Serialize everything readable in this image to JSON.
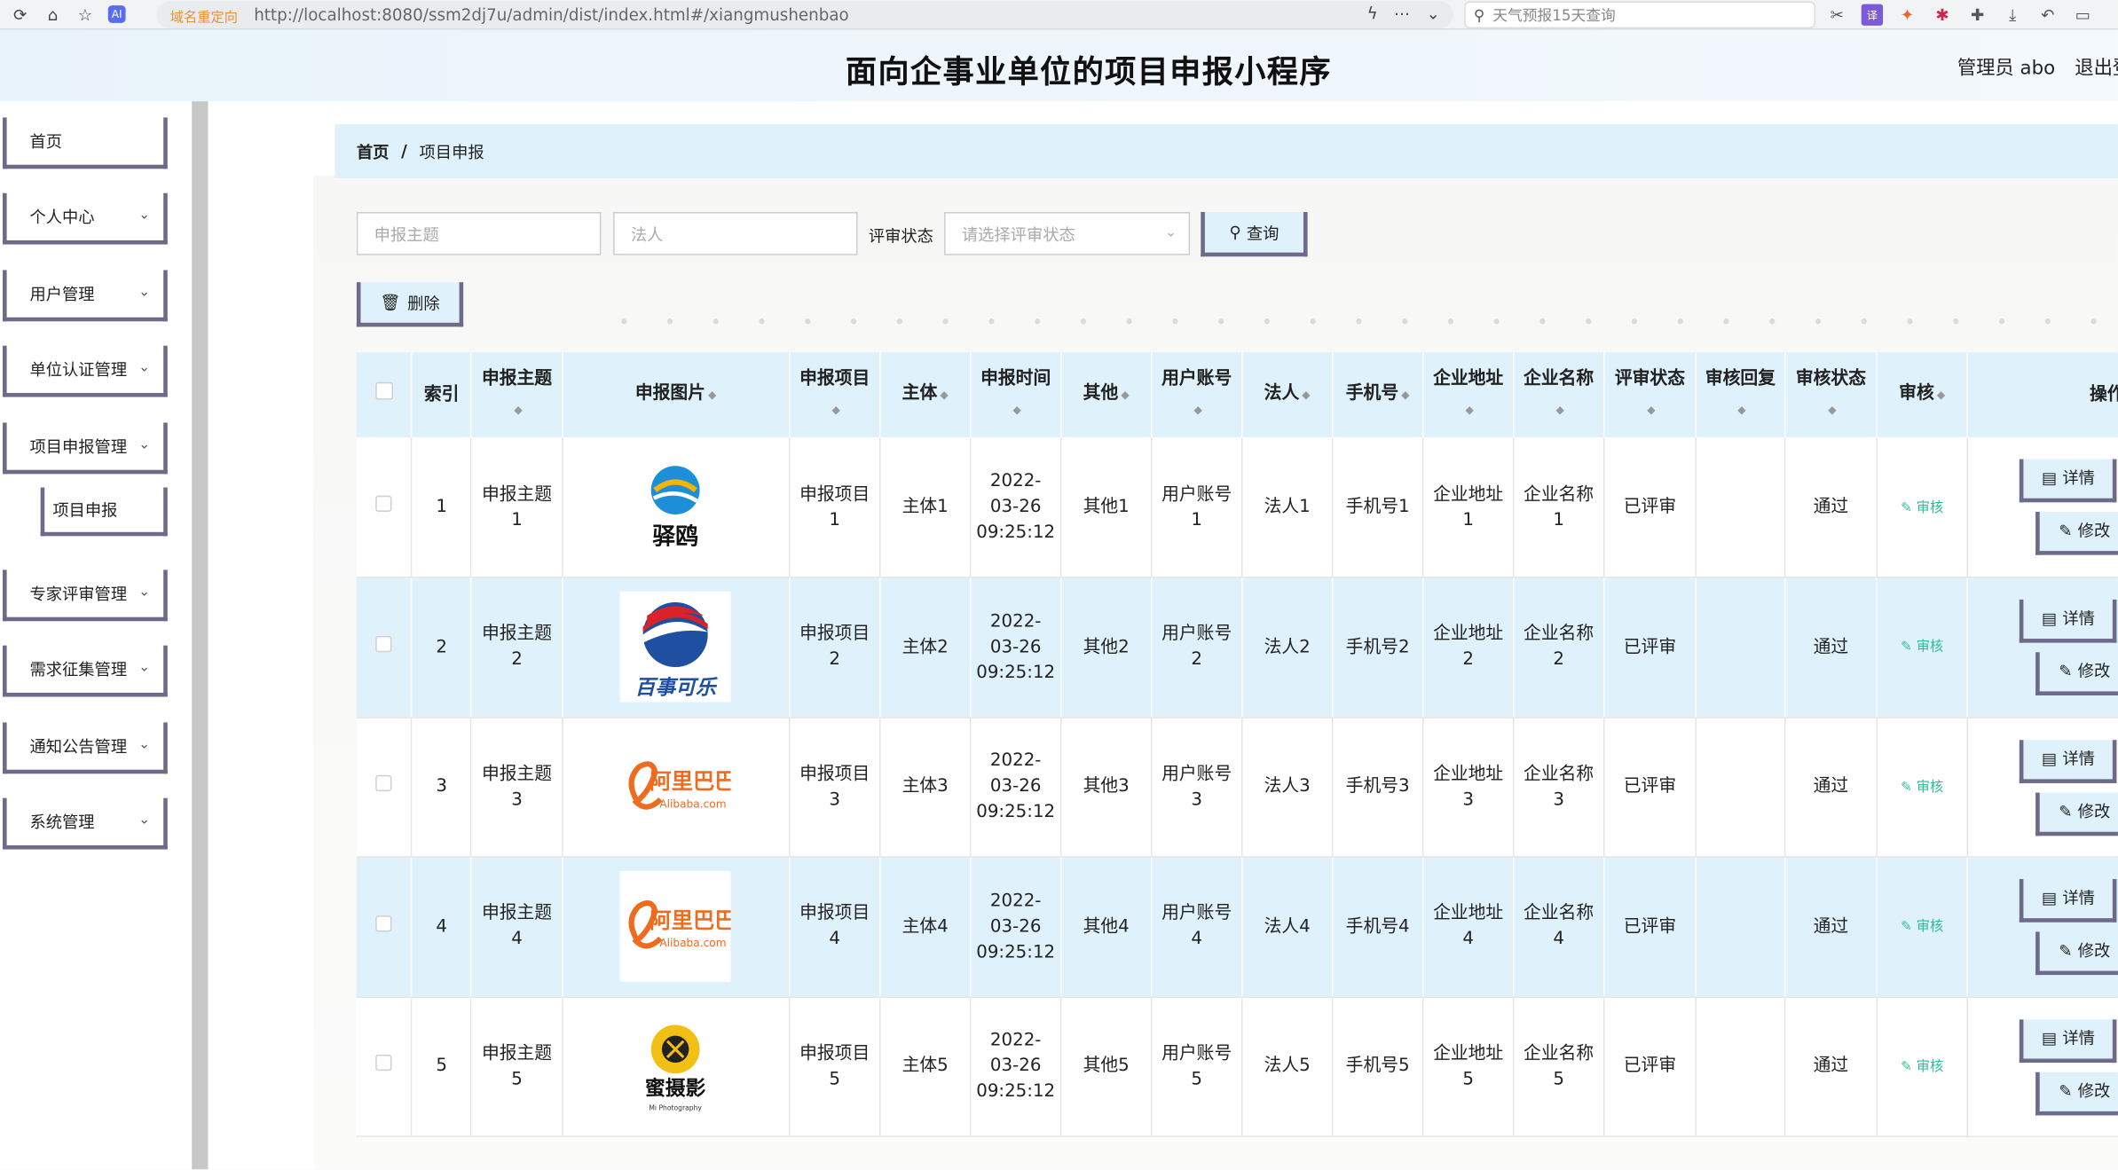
{
  "browser": {
    "redirect_label": "域名重定向",
    "url": "http://localhost:8080/ssm2dj7u/admin/dist/index.html#/xiangmushenbao",
    "search_placeholder": "天气预报15天查询",
    "ai_label": "AI"
  },
  "header": {
    "title": "面向企事业单位的项目申报小程序",
    "user": "管理员 abo",
    "logout": "退出登"
  },
  "sidebar": {
    "items": [
      {
        "label": "首页",
        "has_chevron": false
      },
      {
        "label": "个人中心",
        "has_chevron": true
      },
      {
        "label": "用户管理",
        "has_chevron": true
      },
      {
        "label": "单位认证管理",
        "has_chevron": true
      },
      {
        "label": "项目申报管理",
        "has_chevron": true
      },
      {
        "label": "项目申报",
        "sub": true
      },
      {
        "label": "专家评审管理",
        "has_chevron": true
      },
      {
        "label": "需求征集管理",
        "has_chevron": true
      },
      {
        "label": "通知公告管理",
        "has_chevron": true
      },
      {
        "label": "系统管理",
        "has_chevron": true
      }
    ]
  },
  "breadcrumb": {
    "home": "首页",
    "separator": "/",
    "current": "项目申报"
  },
  "filters": {
    "subject_placeholder": "申报主题",
    "legal_placeholder": "法人",
    "status_label": "评审状态",
    "status_placeholder": "请选择评审状态",
    "query_label": "查询",
    "delete_label": "删除"
  },
  "table": {
    "headers": [
      "索引",
      "申报主题",
      "申报图片",
      "申报项目",
      "主体",
      "申报时间",
      "其他",
      "用户账号",
      "法人",
      "手机号",
      "企业地址",
      "企业名称",
      "评审状态",
      "审核回复",
      "审核状态",
      "审核",
      "操作"
    ],
    "detail_label": "详情",
    "edit_label": "修改",
    "audit_label": "审核",
    "rows": [
      {
        "idx": "1",
        "subject": "申报主题1",
        "logo": "yiyi",
        "logo_text": "驿鸥",
        "project": "申报项目1",
        "body": "主体1",
        "time": "2022-03-26 09:25:12",
        "other": "其他1",
        "account": "用户账号1",
        "legal": "法人1",
        "phone": "手机号1",
        "address": "企业地址1",
        "company": "企业名称1",
        "review": "已评审",
        "reply": "",
        "status": "通过"
      },
      {
        "idx": "2",
        "subject": "申报主题2",
        "logo": "pepsi",
        "logo_text": "百事可乐",
        "project": "申报项目2",
        "body": "主体2",
        "time": "2022-03-26 09:25:12",
        "other": "其他2",
        "account": "用户账号2",
        "legal": "法人2",
        "phone": "手机号2",
        "address": "企业地址2",
        "company": "企业名称2",
        "review": "已评审",
        "reply": "",
        "status": "通过"
      },
      {
        "idx": "3",
        "subject": "申报主题3",
        "logo": "alibaba",
        "logo_text": "阿里巴巴",
        "project": "申报项目3",
        "body": "主体3",
        "time": "2022-03-26 09:25:12",
        "other": "其他3",
        "account": "用户账号3",
        "legal": "法人3",
        "phone": "手机号3",
        "address": "企业地址3",
        "company": "企业名称3",
        "review": "已评审",
        "reply": "",
        "status": "通过"
      },
      {
        "idx": "4",
        "subject": "申报主题4",
        "logo": "alibaba",
        "logo_text": "阿里巴巴",
        "project": "申报项目4",
        "body": "主体4",
        "time": "2022-03-26 09:25:12",
        "other": "其他4",
        "account": "用户账号4",
        "legal": "法人4",
        "phone": "手机号4",
        "address": "企业地址4",
        "company": "企业名称4",
        "review": "已评审",
        "reply": "",
        "status": "通过"
      },
      {
        "idx": "5",
        "subject": "申报主题5",
        "logo": "camera",
        "logo_text": "蜜摄影",
        "project": "申报项目5",
        "body": "主体5",
        "time": "2022-03-26 09:25:12",
        "other": "其他5",
        "account": "用户账号5",
        "legal": "法人5",
        "phone": "手机号5",
        "address": "企业地址5",
        "company": "企业名称5",
        "review": "已评审",
        "reply": "",
        "status": "通过"
      }
    ]
  },
  "colors": {
    "accent_bg": "#dff1fb",
    "button_border": "#6d6a8a",
    "audit_green": "#2bbd9a",
    "alibaba_orange": "#ef6b1e",
    "pepsi_red": "#d9222a",
    "pepsi_blue": "#1e4fa0"
  }
}
